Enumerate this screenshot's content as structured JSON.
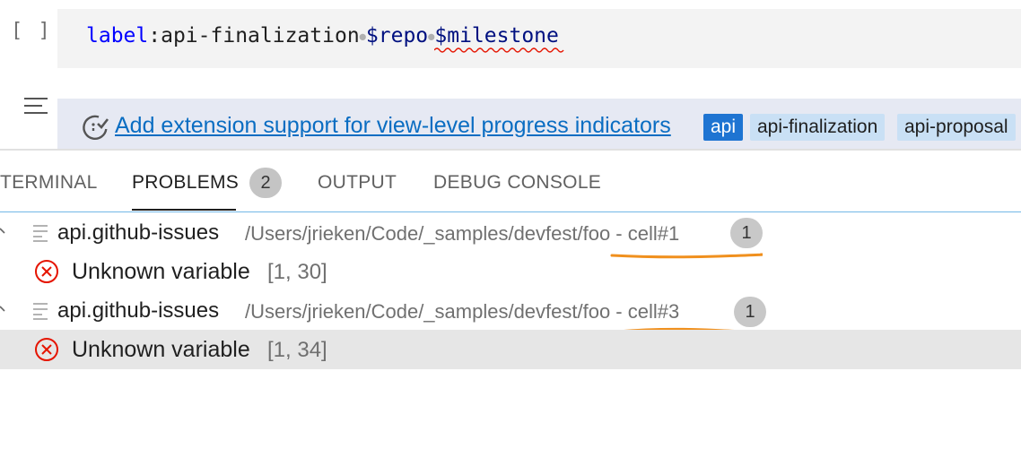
{
  "code_cell": {
    "execution_label": "[ ]",
    "tokens": {
      "label_kw": "label",
      "colon": ":",
      "value": "api-finalization",
      "var1": "$repo",
      "var2": "$milestone"
    }
  },
  "output_cell": {
    "issue_title": "Add extension support for view-level progress indicators",
    "tags": [
      "api",
      "api-finalization",
      "api-proposal"
    ]
  },
  "panel": {
    "tabs": [
      {
        "label": "TERMINAL"
      },
      {
        "label": "PROBLEMS",
        "badge": "2"
      },
      {
        "label": "OUTPUT"
      },
      {
        "label": "DEBUG CONSOLE"
      }
    ],
    "active_tab": "PROBLEMS"
  },
  "problems": [
    {
      "file": "api.github-issues",
      "path": "/Users/jrieken/Code/_samples/devfest/foo - cell#1",
      "count": "1",
      "message": "Unknown variable",
      "position": "[1, 30]"
    },
    {
      "file": "api.github-issues",
      "path": "/Users/jrieken/Code/_samples/devfest/foo - cell#3",
      "count": "1",
      "message": "Unknown variable",
      "position": "[1, 34]"
    }
  ],
  "colors": {
    "accent_link": "#0a6dc2",
    "error": "#e51400",
    "tag_primary": "#1e74d2",
    "tag_secondary": "#c9e0f5",
    "annotation": "#f0901e"
  },
  "icons": [
    "menu-icon",
    "issue-closed-icon",
    "chevron-down-icon",
    "file-icon",
    "error-icon"
  ]
}
